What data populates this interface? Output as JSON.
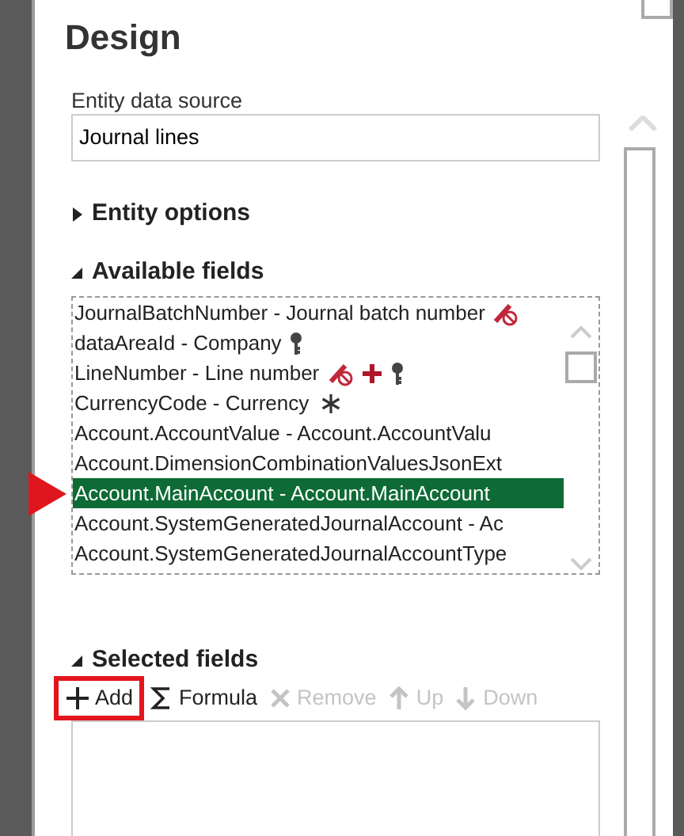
{
  "panel": {
    "title": "Design"
  },
  "data_source": {
    "label": "Entity data source",
    "value": "Journal lines"
  },
  "sections": [
    {
      "label": "Entity options",
      "expanded": false
    },
    {
      "label": "Available fields",
      "expanded": true
    }
  ],
  "available_fields": [
    {
      "label": "JournalBatchNumber - Journal batch number",
      "selected": false,
      "pointed": false,
      "not_editable": true,
      "added": false,
      "key": false,
      "required": false
    },
    {
      "label": "dataAreaId - Company",
      "selected": false,
      "pointed": false,
      "not_editable": false,
      "added": false,
      "key": true,
      "required": false
    },
    {
      "label": "LineNumber - Line number",
      "selected": false,
      "pointed": false,
      "not_editable": true,
      "added": true,
      "key": true,
      "required": false
    },
    {
      "label": "CurrencyCode - Currency",
      "selected": false,
      "pointed": false,
      "not_editable": false,
      "added": false,
      "key": false,
      "required": true
    },
    {
      "label": "Account.AccountValue - Account.AccountValu",
      "selected": false,
      "pointed": false,
      "not_editable": false,
      "added": false,
      "key": false,
      "required": false
    },
    {
      "label": "Account.DimensionCombinationValuesJsonExt",
      "selected": false,
      "pointed": false,
      "not_editable": false,
      "added": false,
      "key": false,
      "required": false
    },
    {
      "label": "Account.MainAccount - Account.MainAccount",
      "selected": true,
      "pointed": true,
      "not_editable": false,
      "added": false,
      "key": false,
      "required": false
    },
    {
      "label": "Account.SystemGeneratedJournalAccount - Ac",
      "selected": false,
      "pointed": false,
      "not_editable": false,
      "added": false,
      "key": false,
      "required": false
    },
    {
      "label": "Account.SystemGeneratedJournalAccountType",
      "selected": false,
      "pointed": false,
      "not_editable": false,
      "added": false,
      "key": false,
      "required": false
    }
  ],
  "selected_section": {
    "label": "Selected fields",
    "expanded": true
  },
  "toolbar": [
    {
      "kind": "add",
      "label": "Add",
      "disabled": false,
      "highlighted": true
    },
    {
      "kind": "formula",
      "label": "Formula",
      "disabled": false,
      "highlighted": false
    },
    {
      "kind": "remove",
      "label": "Remove",
      "disabled": true,
      "highlighted": false
    },
    {
      "kind": "up",
      "label": "Up",
      "disabled": true,
      "highlighted": false
    },
    {
      "kind": "down",
      "label": "Down",
      "disabled": true,
      "highlighted": false
    }
  ]
}
